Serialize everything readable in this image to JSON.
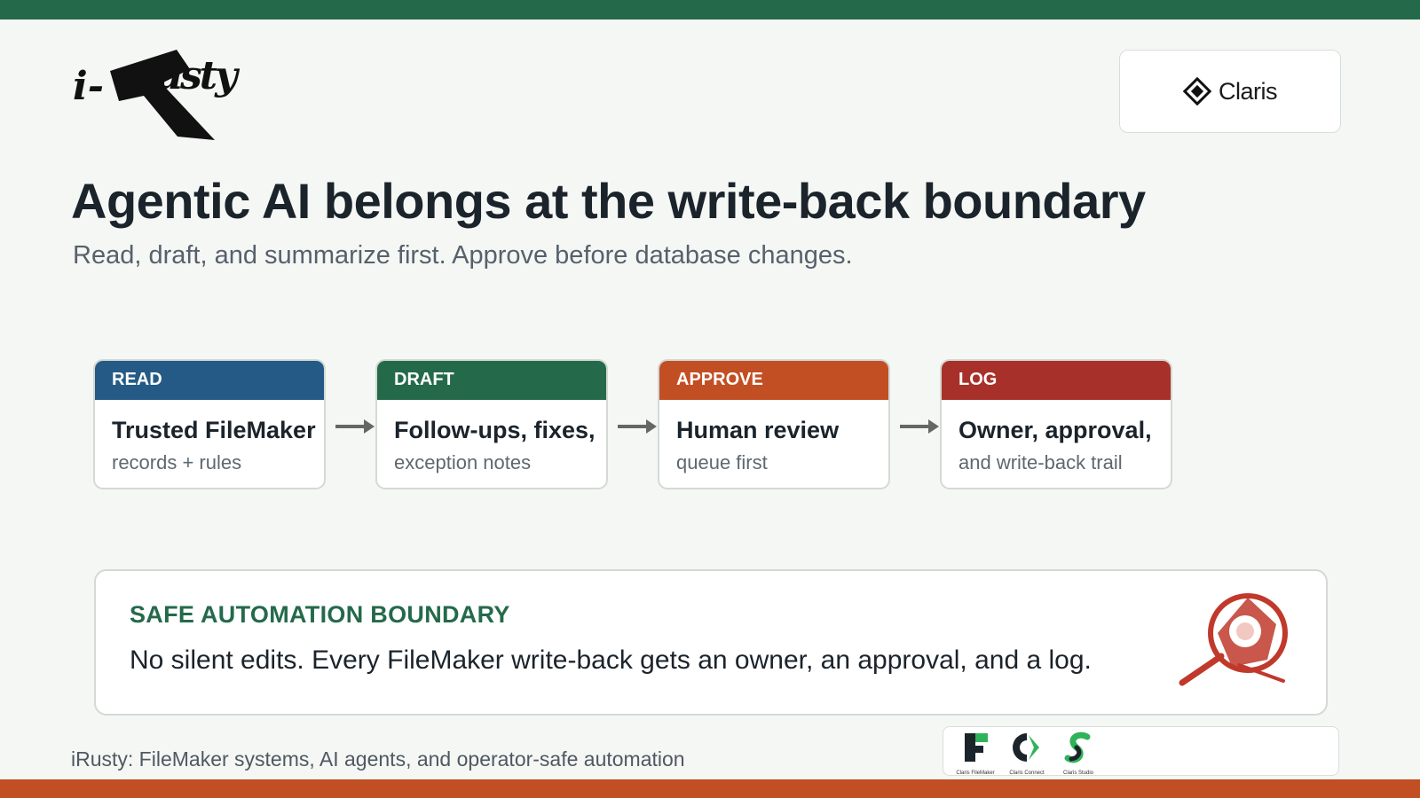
{
  "brand": {
    "logo_text": "iRusty",
    "partner": "Claris"
  },
  "title": "Agentic AI belongs at the write-back boundary",
  "subtitle": "Read, draft, and summarize first. Approve before database changes.",
  "steps": [
    {
      "tag": "READ",
      "title": "Trusted FileMaker",
      "sub": "records + rules",
      "color": "#245a85"
    },
    {
      "tag": "DRAFT",
      "title": "Follow-ups, fixes,",
      "sub": "exception notes",
      "color": "#246a4a"
    },
    {
      "tag": "APPROVE",
      "title": "Human review",
      "sub": "queue first",
      "color": "#c24f24"
    },
    {
      "tag": "LOG",
      "title": "Owner, approval,",
      "sub": "and write-back trail",
      "color": "#a8302a"
    }
  ],
  "boundary": {
    "label": "SAFE AUTOMATION BOUNDARY",
    "text": "No silent edits. Every FileMaker write-back gets an owner, an approval, and a log."
  },
  "footer": "iRusty: FileMaker systems, AI agents, and operator-safe automation",
  "products": [
    "Claris FileMaker",
    "Claris Connect",
    "Claris Studio"
  ],
  "colors": {
    "top_bar": "#246a4a",
    "bottom_bar": "#c24f24",
    "accent_green": "#246a4a",
    "magnifier_red": "#c0392b"
  },
  "icons": [
    "claris-logo-icon",
    "arrow-right-icon",
    "magnifier-icon",
    "filemaker-icon",
    "claris-connect-icon",
    "claris-studio-icon"
  ]
}
